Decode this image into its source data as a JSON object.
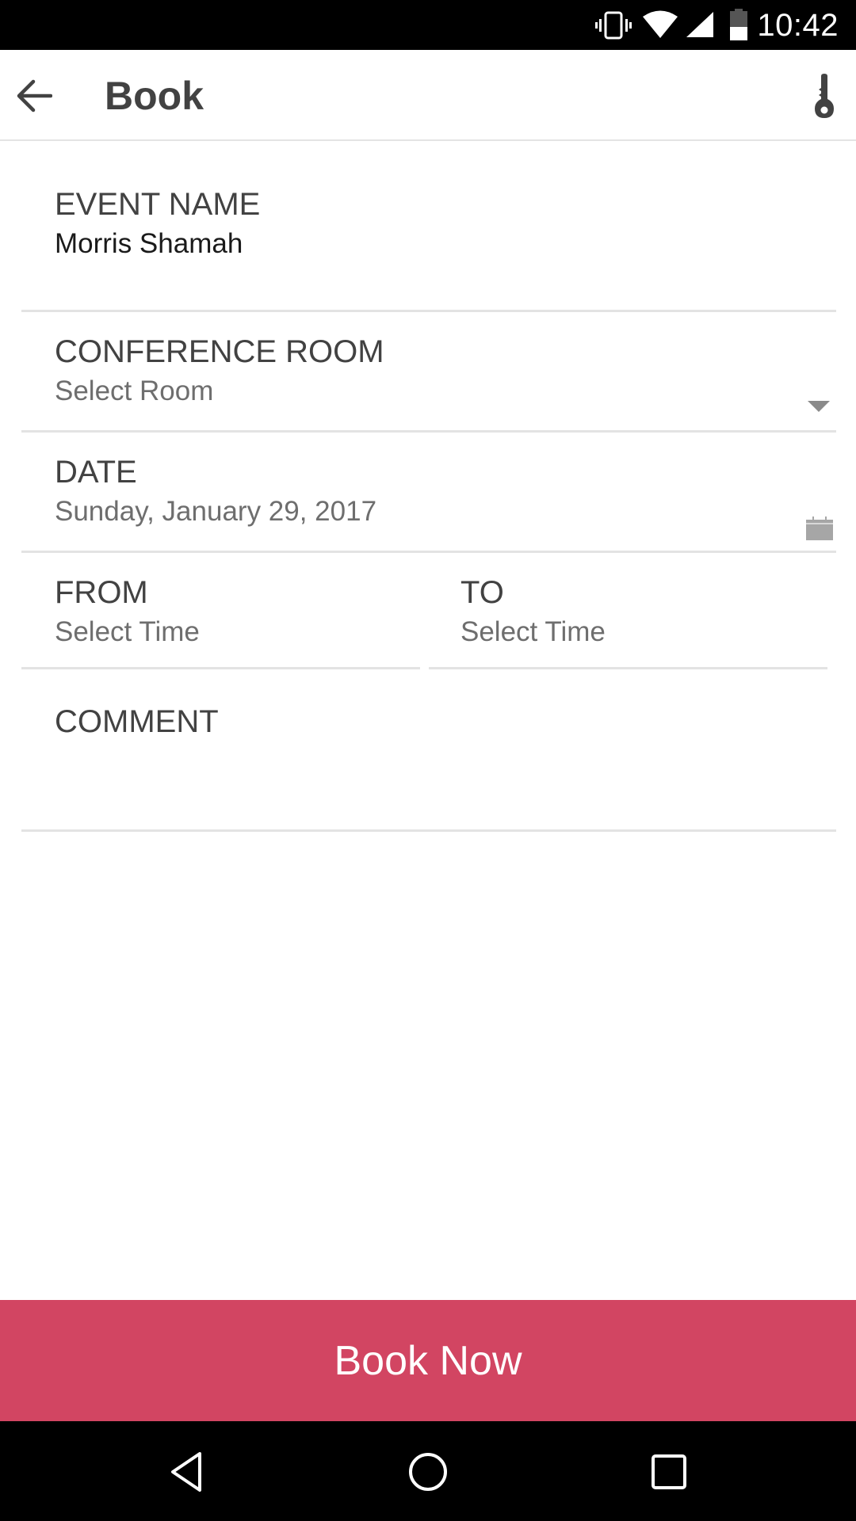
{
  "status_bar": {
    "time": "10:42",
    "icons": [
      "vibrate-icon",
      "wifi-icon",
      "cell-signal-icon",
      "battery-icon"
    ]
  },
  "app_bar": {
    "title": "Book",
    "back_icon": "arrow-back-icon",
    "action_icon": "key-icon"
  },
  "form": {
    "event_name": {
      "label": "EVENT NAME",
      "value": "Morris Shamah"
    },
    "conference_room": {
      "label": "CONFERENCE ROOM",
      "value": "Select Room",
      "icon": "dropdown-arrow-icon"
    },
    "date": {
      "label": "DATE",
      "value": "Sunday, January 29, 2017",
      "icon": "calendar-icon"
    },
    "from": {
      "label": "FROM",
      "value": "Select Time"
    },
    "to": {
      "label": "TO",
      "value": "Select Time"
    },
    "comment": {
      "label": "COMMENT",
      "value": ""
    }
  },
  "actions": {
    "book_now_label": "Book Now",
    "accent_color": "#d24562"
  },
  "nav_bar": {
    "icons": [
      "back-triangle-icon",
      "home-circle-icon",
      "recents-square-icon"
    ]
  }
}
